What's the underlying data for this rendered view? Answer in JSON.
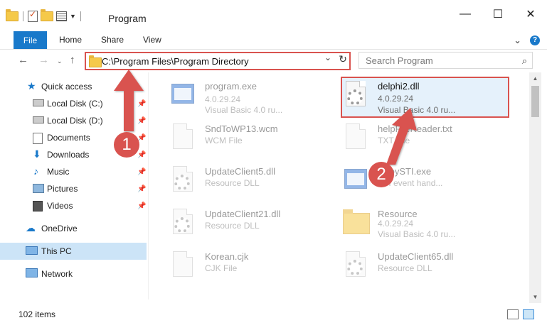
{
  "window": {
    "title": "Program",
    "minimize": "—",
    "maximize": "☐",
    "close": "✕"
  },
  "ribbon": {
    "tabs": [
      "File",
      "Home",
      "Share",
      "View"
    ],
    "expand": "⌄",
    "help": "?"
  },
  "address": {
    "path": "C:\\Program Files\\Program Directory",
    "search_placeholder": "Search Program"
  },
  "sidebar": {
    "items": [
      {
        "label": "Quick access",
        "icon": "star-icon"
      },
      {
        "label": "Local Disk (C:)",
        "icon": "drive-icon",
        "pinned": true
      },
      {
        "label": "Local Disk (D:)",
        "icon": "drive-icon",
        "pinned": true
      },
      {
        "label": "Documents",
        "icon": "documents-icon",
        "pinned": true
      },
      {
        "label": "Downloads",
        "icon": "downloads-icon",
        "pinned": true
      },
      {
        "label": "Music",
        "icon": "music-icon",
        "pinned": true
      },
      {
        "label": "Pictures",
        "icon": "pictures-icon",
        "pinned": true
      },
      {
        "label": "Videos",
        "icon": "videos-icon",
        "pinned": true
      },
      {
        "label": "OneDrive",
        "icon": "cloud-icon"
      },
      {
        "label": "This PC",
        "icon": "computer-icon",
        "selected": true
      },
      {
        "label": "Network",
        "icon": "network-icon"
      }
    ]
  },
  "files": [
    {
      "name": "program.exe",
      "sub1": "4.0.29.24",
      "sub2": "Visual Basic 4.0 ru...",
      "icon": "exe-icon"
    },
    {
      "name": "delphi2.dll",
      "sub1": "4.0.29.24",
      "sub2": "Visual Basic 4.0 ru...",
      "icon": "dll-icon",
      "highlighted": true
    },
    {
      "name": "SndToWP13.wcm",
      "sub1": "WCM File",
      "icon": "file-icon"
    },
    {
      "name": "helpFileReader.txt",
      "sub1": "TXT File",
      "icon": "file-icon"
    },
    {
      "name": "UpdateClient5.dll",
      "sub1": "Resource DLL",
      "icon": "dll-icon"
    },
    {
      "name": "CopySTI.exe",
      "sub1": "STI event hand...",
      "icon": "exe-icon"
    },
    {
      "name": "UpdateClient21.dll",
      "sub1": "Resource DLL",
      "icon": "dll-icon"
    },
    {
      "name": "Resource",
      "sub1": "4.0.29.24",
      "sub2": "Visual Basic 4.0 ru...",
      "icon": "folder-icon"
    },
    {
      "name": "Korean.cjk",
      "sub1": "CJK File",
      "icon": "file-icon"
    },
    {
      "name": "UpdateClient65.dll",
      "sub1": "Resource DLL",
      "icon": "dll-icon"
    }
  ],
  "status": {
    "count": "102 items"
  },
  "callouts": [
    "1",
    "2"
  ],
  "colors": {
    "accent": "#1979ca",
    "highlight_border": "#d9534f",
    "selection": "#cce4f7"
  }
}
